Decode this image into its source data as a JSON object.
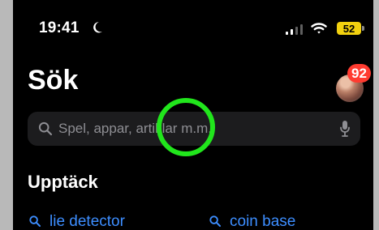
{
  "status_bar": {
    "time": "19:41",
    "battery": "52"
  },
  "header": {
    "title": "Sök",
    "notification_count": "92"
  },
  "search": {
    "placeholder": "Spel, appar, artiklar m.m.",
    "value": ""
  },
  "discover": {
    "title": "Upptäck",
    "items": [
      {
        "label": "lie detector",
        "icon": "search-icon"
      },
      {
        "label": "coin base",
        "icon": "search-icon"
      }
    ]
  },
  "colors": {
    "background": "#000000",
    "search_field": "#1c1c1e",
    "link": "#3d8eff",
    "badge": "#ff3b30",
    "battery": "#f2d10f",
    "highlight": "#21e61c"
  },
  "icons": {
    "moon": "moon-icon",
    "signal": "signal-icon",
    "wifi": "wifi-icon",
    "search": "search-icon",
    "microphone": "microphone-icon"
  }
}
